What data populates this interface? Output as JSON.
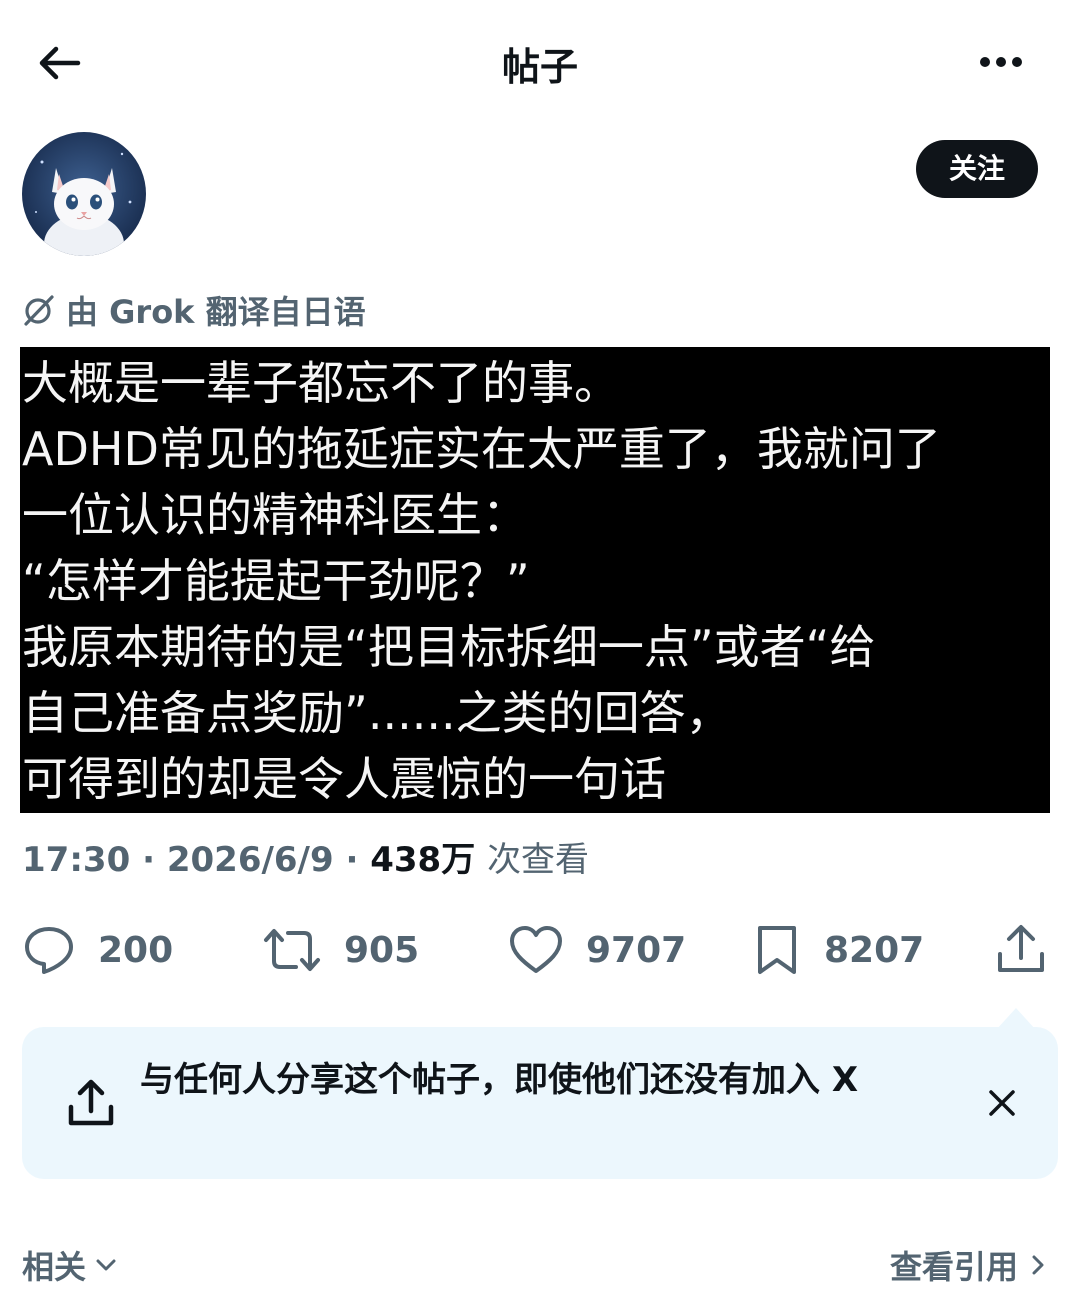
{
  "header": {
    "title": "帖子"
  },
  "follow_label": "关注",
  "translation": {
    "text": "由 Grok 翻译自日语"
  },
  "post_image_lines": [
    "大概是一辈子都忘不了的事。",
    "ADHD常见的拖延症实在太严重了，我就问了",
    "一位认识的精神科医生：",
    "“怎样才能提起干劲呢？”",
    "我原本期待的是“把目标拆细一点”或者“给",
    "自己准备点奖励”......之类的回答，",
    "可得到的却是令人震惊的一句话"
  ],
  "meta": {
    "time": "17:30",
    "date": "2026/6/9",
    "views": "438万",
    "views_suffix": "次查看",
    "sep": "·"
  },
  "actions": {
    "replies": "200",
    "reposts": "905",
    "likes": "9707",
    "bookmarks": "8207"
  },
  "share_prompt": {
    "text": "与任何人分享这个帖子，即使他们还没有加入 X"
  },
  "footer": {
    "related": "相关",
    "quotes": "查看引用"
  },
  "colors": {
    "primary_text": "#0f1419",
    "secondary_text": "#536471",
    "banner_bg": "#ecf7fd"
  }
}
